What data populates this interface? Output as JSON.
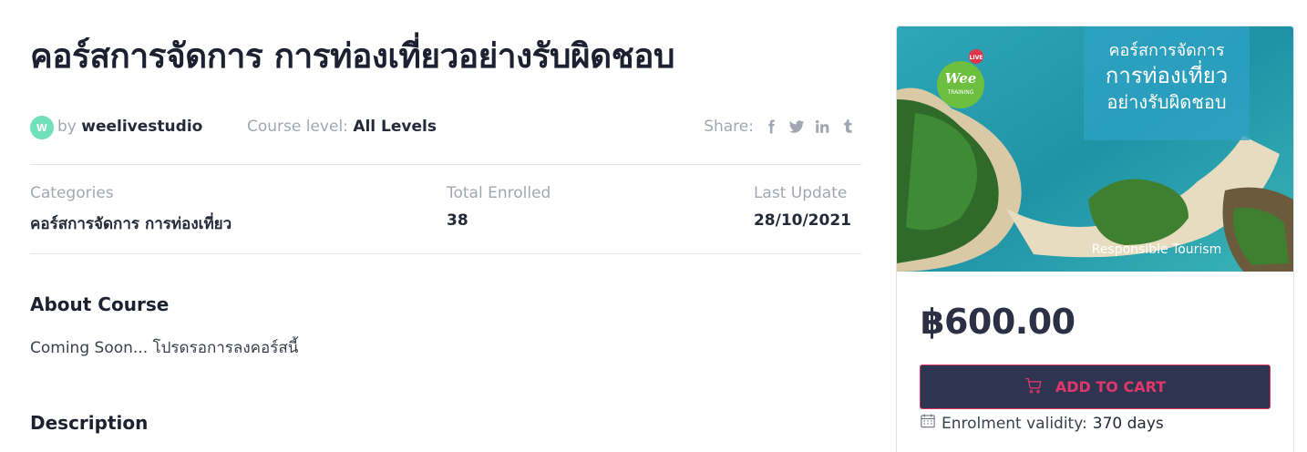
{
  "course": {
    "title": "คอร์สการจัดการ การท่องเที่ยวอย่างรับผิดชอบ",
    "avatar_letter": "W",
    "by_prefix": "by ",
    "author": "weelivestudio",
    "level_label": "Course level: ",
    "level_value": "All Levels",
    "share_label": "Share:",
    "share_icons": [
      "facebook-icon",
      "twitter-icon",
      "linkedin-icon",
      "tumblr-icon"
    ]
  },
  "stats": {
    "categories_label": "Categories",
    "categories_value": "คอร์สการจัดการ การท่องเที่ยว",
    "enrolled_label": "Total Enrolled",
    "enrolled_value": "38",
    "updated_label": "Last Update",
    "updated_value": "28/10/2021"
  },
  "about": {
    "heading": "About Course",
    "text": "Coming Soon... โปรดรอการลงคอร์สนี้"
  },
  "description": {
    "heading": "Description"
  },
  "sidebar": {
    "thumbnail": {
      "logo_text": "Wee",
      "logo_sub": "TRAINING",
      "logo_badge": "LIVE",
      "line1": "คอร์สการจัดการ",
      "line2": "การท่องเที่ยว",
      "line3": "อย่างรับผิดชอบ",
      "caption": "Responsible Tourism"
    },
    "price": "฿600.00",
    "add_to_cart": "ADD TO CART",
    "validity_label": "Enrolment validity: ",
    "validity_value": "370 days"
  },
  "colors": {
    "accent": "#e0366a",
    "button_bg": "#2f3550",
    "avatar": "#6fe0b9",
    "muted": "#a3a7b4"
  }
}
